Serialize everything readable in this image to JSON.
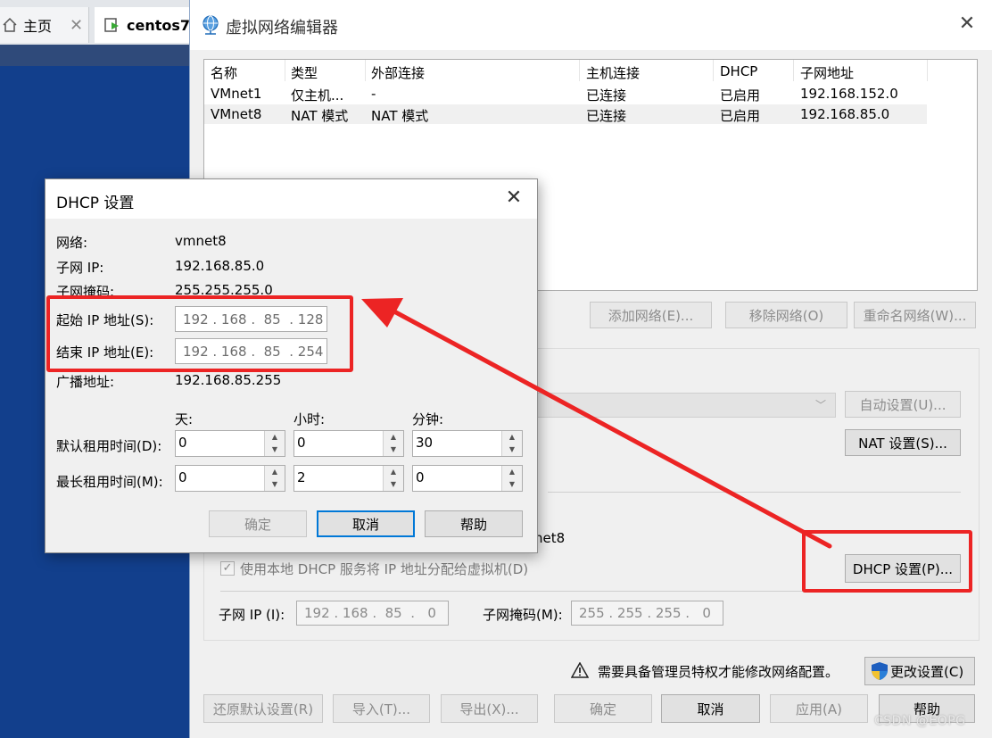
{
  "background": {
    "tabs": [
      {
        "label": "主页"
      },
      {
        "label": "centos7"
      }
    ]
  },
  "editor": {
    "title": "虚拟网络编辑器",
    "table": {
      "headers": [
        "名称",
        "类型",
        "外部连接",
        "主机连接",
        "DHCP",
        "子网地址"
      ],
      "rows": [
        [
          "VMnet1",
          "仅主机...",
          "-",
          "已连接",
          "已启用",
          "192.168.152.0"
        ],
        [
          "VMnet8",
          "NAT 模式",
          "NAT 模式",
          "已连接",
          "已启用",
          "192.168.85.0"
        ]
      ]
    },
    "buttons": {
      "add_network": "添加网络(E)...",
      "remove_network": "移除网络(O)",
      "rename_network": "重命名网络(W)...",
      "auto_settings": "自动设置(U)...",
      "nat_settings": "NAT 设置(S)...",
      "dhcp_settings": "DHCP 设置(P)...",
      "change_settings": "更改设置(C)",
      "restore_defaults": "还原默认设置(R)",
      "import": "导入(T)...",
      "export": "导出(X)...",
      "ok": "确定",
      "cancel": "取消",
      "apply": "应用(A)",
      "help": "帮助"
    },
    "vmnet_info_partial": "net8",
    "use_dhcp_label": "使用本地 DHCP 服务将 IP 地址分配给虚拟机(D)",
    "use_dhcp_checked": true,
    "subnet_ip_label": "子网 IP (I):",
    "subnet_ip_value": "192 . 168 .  85  .   0",
    "subnet_mask_label": "子网掩码(M):",
    "subnet_mask_value": "255 . 255 . 255 .   0",
    "admin_notice": "需要具备管理员特权才能修改网络配置。"
  },
  "dhcp_dialog": {
    "title": "DHCP 设置",
    "network_label": "网络:",
    "network_value": "vmnet8",
    "subnet_ip_label": "子网 IP:",
    "subnet_ip_value": "192.168.85.0",
    "subnet_mask_label": "子网掩码:",
    "subnet_mask_value": "255.255.255.0",
    "start_ip_label": "起始 IP 地址(S):",
    "start_ip_value": "192 . 168 .  85  . 128",
    "end_ip_label": "结束 IP 地址(E):",
    "end_ip_value": "192 . 168 .  85  . 254",
    "broadcast_label": "广播地址:",
    "broadcast_value": "192.168.85.255",
    "col_days": "天:",
    "col_hours": "小时:",
    "col_minutes": "分钟:",
    "default_lease_label": "默认租用时间(D):",
    "default_lease": {
      "days": "0",
      "hours": "0",
      "minutes": "30"
    },
    "max_lease_label": "最长租用时间(M):",
    "max_lease": {
      "days": "0",
      "hours": "2",
      "minutes": "0"
    },
    "ok": "确定",
    "cancel": "取消",
    "help": "帮助"
  },
  "annotation_color": "#ec2424",
  "watermark": "CSDN @EOPG"
}
